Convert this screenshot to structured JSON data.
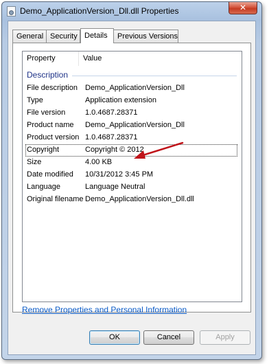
{
  "window": {
    "title": "Demo_ApplicationVersion_Dll.dll Properties",
    "close_label": "✕"
  },
  "tabs": [
    {
      "label": "General"
    },
    {
      "label": "Security"
    },
    {
      "label": "Details"
    },
    {
      "label": "Previous Versions"
    }
  ],
  "listview": {
    "col_property": "Property",
    "col_value": "Value",
    "group_label": "Description",
    "rows": [
      {
        "key": "File description",
        "value": "Demo_ApplicationVersion_Dll"
      },
      {
        "key": "Type",
        "value": "Application extension"
      },
      {
        "key": "File version",
        "value": "1.0.4687.28371"
      },
      {
        "key": "Product name",
        "value": "Demo_ApplicationVersion_Dll"
      },
      {
        "key": "Product version",
        "value": "1.0.4687.28371"
      },
      {
        "key": "Copyright",
        "value": "Copyright ©  2012"
      },
      {
        "key": "Size",
        "value": "4.00 KB"
      },
      {
        "key": "Date modified",
        "value": "10/31/2012 3:45 PM"
      },
      {
        "key": "Language",
        "value": "Language Neutral"
      },
      {
        "key": "Original filename",
        "value": "Demo_ApplicationVersion_Dll.dll"
      }
    ]
  },
  "link": {
    "label": "Remove Properties and Personal Information"
  },
  "buttons": {
    "ok": "OK",
    "cancel": "Cancel",
    "apply": "Apply"
  },
  "colors": {
    "annotation_arrow": "#c0141a",
    "link": "#0b5bc7",
    "group_header": "#1e3287"
  }
}
